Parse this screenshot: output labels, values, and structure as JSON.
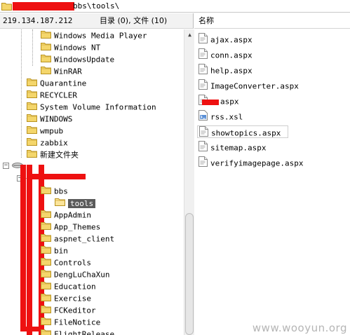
{
  "path": {
    "text": "bbs\\tools\\"
  },
  "left_header": {
    "ip": "219.134.187.212",
    "counts": "目录 (0), 文件 (10)"
  },
  "right_header": {
    "name_column": "名称"
  },
  "tree": {
    "items": [
      {
        "label": "Windows Media Player",
        "indent": 3
      },
      {
        "label": "Windows NT",
        "indent": 3
      },
      {
        "label": "WindowsUpdate",
        "indent": 3
      },
      {
        "label": "WinRAR",
        "indent": 3
      },
      {
        "label": "Quarantine",
        "indent": 2
      },
      {
        "label": "RECYCLER",
        "indent": 2
      },
      {
        "label": "System Volume Information",
        "indent": 2
      },
      {
        "label": "WINDOWS",
        "indent": 2
      },
      {
        "label": "wmpub",
        "indent": 2
      },
      {
        "label": "zabbix",
        "indent": 2
      },
      {
        "label": "新建文件夹",
        "indent": 2
      }
    ],
    "site_items": [
      {
        "label": "bbs"
      },
      {
        "label": "tools",
        "selected": true
      },
      {
        "label": "AppAdmin"
      },
      {
        "label": "App_Themes"
      },
      {
        "label": "aspnet_client"
      },
      {
        "label": "bin"
      },
      {
        "label": "Controls"
      },
      {
        "label": "DengLuChaXun"
      },
      {
        "label": "Education"
      },
      {
        "label": "Exercise"
      },
      {
        "label": "FCKeditor"
      },
      {
        "label": "FileNotice"
      },
      {
        "label": "FlightRelease"
      }
    ]
  },
  "files": [
    {
      "name": "ajax.aspx",
      "icon": "document-icon"
    },
    {
      "name": "conn.aspx",
      "icon": "document-icon"
    },
    {
      "name": "help.aspx",
      "icon": "document-icon"
    },
    {
      "name": "ImageConverter.aspx",
      "icon": "document-icon"
    },
    {
      "name": "aspx",
      "icon": "document-icon",
      "redacted": true
    },
    {
      "name": "rss.xsl",
      "icon": "xsl-document-icon"
    },
    {
      "name": "showtopics.aspx",
      "icon": "document-icon",
      "highlighted": true
    },
    {
      "name": "sitemap.aspx",
      "icon": "document-icon"
    },
    {
      "name": "verifyimagepage.aspx",
      "icon": "document-icon"
    }
  ],
  "watermark": "www.wooyun.org",
  "colors": {
    "redaction": "#ee1111",
    "folder": "#f4d66b",
    "selected_bg": "#5b5b5b"
  }
}
